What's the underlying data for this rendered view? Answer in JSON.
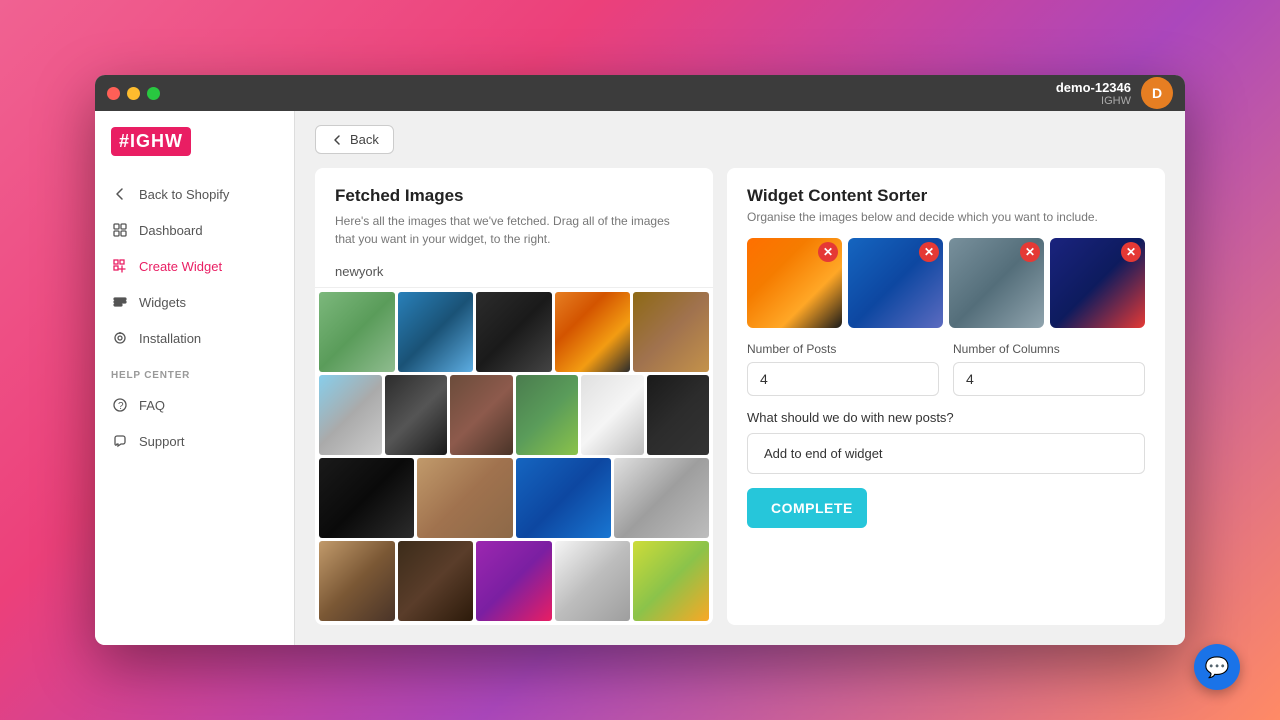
{
  "app": {
    "logo": "#IGHW",
    "titlebar": {
      "traffic_lights": [
        "red",
        "yellow",
        "green"
      ]
    },
    "user": {
      "initial": "D",
      "name": "demo-12346",
      "store": "IGHW"
    }
  },
  "sidebar": {
    "nav": [
      {
        "id": "back-shopify",
        "label": "Back to Shopify",
        "icon": "arrow-left"
      },
      {
        "id": "dashboard",
        "label": "Dashboard",
        "icon": "dashboard"
      },
      {
        "id": "create-widget",
        "label": "Create Widget",
        "icon": "create"
      },
      {
        "id": "widgets",
        "label": "Widgets",
        "icon": "widgets"
      },
      {
        "id": "installation",
        "label": "Installation",
        "icon": "installation"
      }
    ],
    "help_center_label": "HELP CENTER",
    "help_items": [
      {
        "id": "faq",
        "label": "FAQ",
        "icon": "question"
      },
      {
        "id": "support",
        "label": "Support",
        "icon": "chat"
      }
    ]
  },
  "back_button": "Back",
  "fetched_images": {
    "title": "Fetched Images",
    "description": "Here's all the images that we've fetched. Drag all of the images that you want in your widget, to the right.",
    "tag": "newyork"
  },
  "widget_sorter": {
    "title": "Widget Content Sorter",
    "description": "Organise the images below and decide which you want to include.",
    "preview_images": [
      {
        "id": "prev1",
        "color_class": "prev-sunset"
      },
      {
        "id": "prev2",
        "color_class": "prev-sky"
      },
      {
        "id": "prev3",
        "color_class": "prev-bridge"
      },
      {
        "id": "prev4",
        "color_class": "prev-night"
      }
    ],
    "number_of_posts_label": "Number of Posts",
    "number_of_posts_value": "4",
    "number_of_columns_label": "Number of Columns",
    "number_of_columns_value": "4",
    "new_posts_label": "What should we do with new posts?",
    "new_posts_option": "Add to end of widget",
    "complete_button": "COMPLETE"
  },
  "image_rows": [
    [
      {
        "color": "img-horse"
      },
      {
        "color": "img-ocean"
      },
      {
        "color": "img-dark"
      },
      {
        "color": "img-night"
      },
      {
        "color": "img-cat"
      }
    ],
    [
      {
        "color": "img-sky"
      },
      {
        "color": "img-person"
      },
      {
        "color": "img-woman"
      },
      {
        "color": "img-floral"
      },
      {
        "color": "img-white"
      },
      {
        "color": "img-text"
      }
    ],
    [
      {
        "color": "img-dark2"
      },
      {
        "color": "img-face"
      },
      {
        "color": "img-abstract"
      },
      {
        "color": "img-patterns"
      }
    ],
    [
      {
        "color": "img-girl1"
      },
      {
        "color": "img-dark3"
      },
      {
        "color": "img-pattern"
      },
      {
        "color": "img-sphere"
      },
      {
        "color": "img-graffiti"
      }
    ]
  ]
}
